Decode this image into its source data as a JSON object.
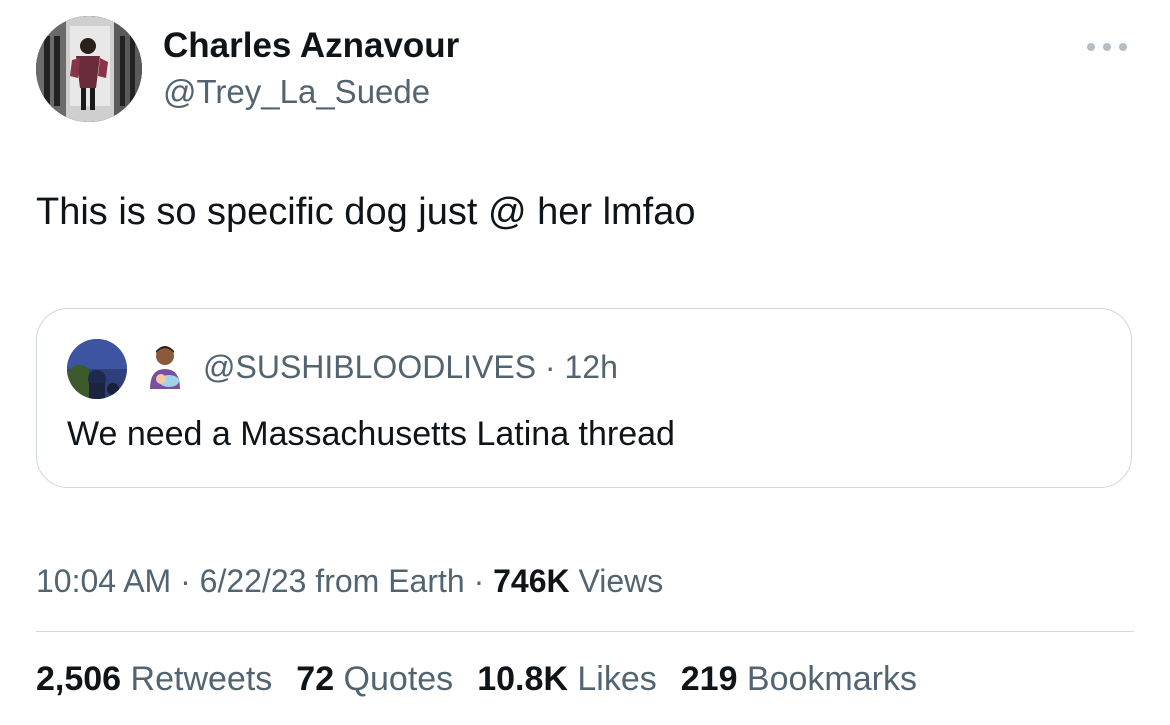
{
  "author": {
    "display_name": "Charles Aznavour",
    "handle": "@Trey_La_Suede"
  },
  "more_icon": "ellipsis-icon",
  "tweet": {
    "text": "This is so specific dog just @ her lmfao"
  },
  "quote": {
    "emoji_icon": "man-feeding-baby-icon",
    "handle": "@SUSHIBLOODLIVES",
    "separator": " · ",
    "age": "12h",
    "text": "We need a Massachusetts Latina thread"
  },
  "meta": {
    "time": "10:04 AM",
    "sep1": " · ",
    "date": "6/22/23",
    "source": " from Earth",
    "sep2": " · ",
    "views_count": "746K",
    "views_label": " Views"
  },
  "stats": [
    {
      "count": "2,506",
      "label": " Retweets"
    },
    {
      "count": "72",
      "label": " Quotes"
    },
    {
      "count": "10.8K",
      "label": " Likes"
    },
    {
      "count": "219",
      "label": " Bookmarks"
    }
  ],
  "colors": {
    "text_primary": "#0f1419",
    "text_secondary": "#536471",
    "border": "#cfd9de"
  }
}
